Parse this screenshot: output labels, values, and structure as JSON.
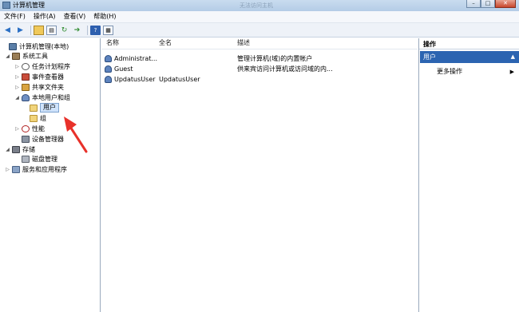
{
  "window": {
    "title": "计算机管理",
    "ghost_title": "无法访问主机",
    "controls": {
      "minimize": "–",
      "maximize": "□",
      "close": "✕"
    }
  },
  "menu": [
    "文件(F)",
    "操作(A)",
    "查看(V)",
    "帮助(H)"
  ],
  "toolbar": {
    "icons": [
      "back-arrow-icon",
      "forward-arrow-icon",
      "up-folder-icon",
      "show-hide-tree-icon",
      "refresh-icon",
      "export-icon",
      "help-icon",
      "properties-icon"
    ]
  },
  "tree": [
    {
      "label": "计算机管理(本地)",
      "icon": "computer-icon",
      "level": 0,
      "toggle": ""
    },
    {
      "label": "系统工具",
      "icon": "tools-icon",
      "level": 1,
      "toggle": "◢"
    },
    {
      "label": "任务计划程序",
      "icon": "clock-icon",
      "level": 2,
      "toggle": "▷"
    },
    {
      "label": "事件查看器",
      "icon": "event-viewer-icon",
      "level": 2,
      "toggle": "▷"
    },
    {
      "label": "共享文件夹",
      "icon": "shared-folder-icon",
      "level": 2,
      "toggle": "▷"
    },
    {
      "label": "本地用户和组",
      "icon": "users-icon",
      "level": 2,
      "toggle": "◢"
    },
    {
      "label": "用户",
      "icon": "folder-icon",
      "level": 3,
      "toggle": "",
      "selected": true
    },
    {
      "label": "组",
      "icon": "folder-icon",
      "level": 3,
      "toggle": ""
    },
    {
      "label": "性能",
      "icon": "performance-icon",
      "level": 2,
      "toggle": "▷"
    },
    {
      "label": "设备管理器",
      "icon": "device-manager-icon",
      "level": 2,
      "toggle": ""
    },
    {
      "label": "存储",
      "icon": "storage-icon",
      "level": 1,
      "toggle": "◢"
    },
    {
      "label": "磁盘管理",
      "icon": "disk-icon",
      "level": 2,
      "toggle": ""
    },
    {
      "label": "服务和应用程序",
      "icon": "services-icon",
      "level": 1,
      "toggle": "▷"
    }
  ],
  "list": {
    "columns": [
      "名称",
      "全名",
      "描述"
    ],
    "rows": [
      {
        "name": "Administrat...",
        "fullname": "",
        "description": "管理计算机(域)的内置帐户"
      },
      {
        "name": "Guest",
        "fullname": "",
        "description": "供来宾访问计算机或访问域的内..."
      },
      {
        "name": "UpdatusUser",
        "fullname": "UpdatusUser",
        "description": ""
      }
    ]
  },
  "actions": {
    "header": "操作",
    "section": "用户",
    "section_caret": "▲",
    "more": "更多操作",
    "more_arrow": "▶"
  },
  "annotation": {
    "color": "#e8312a"
  }
}
